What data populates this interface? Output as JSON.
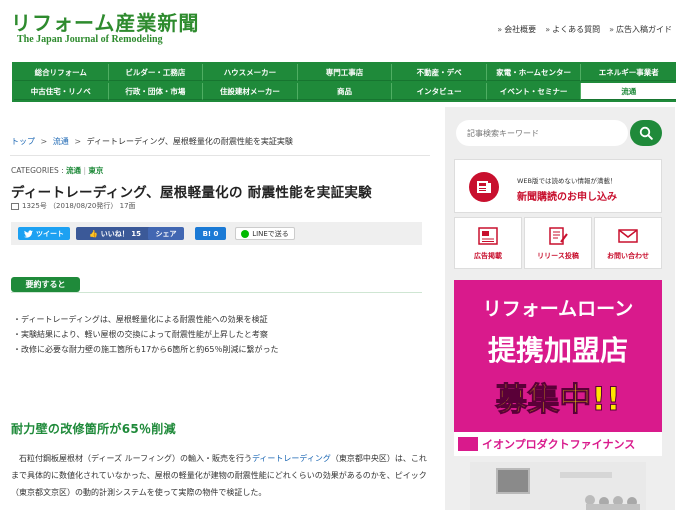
{
  "header": {
    "site_title": "リフォーム産業新聞",
    "site_subtitle": "The Japan Journal of Remodeling",
    "links": [
      "会社概要",
      "よくある質問",
      "広告入稿ガイド"
    ]
  },
  "nav": {
    "row1": [
      "総合リフォーム",
      "ビルダー・工務店",
      "ハウスメーカー",
      "専門工事店",
      "不動産・デベ",
      "家電・ホームセンター",
      "エネルギー事業者"
    ],
    "row2": [
      "中古住宅・リノベ",
      "行政・団体・市場",
      "住設建材メーカー",
      "商品",
      "インタビュー",
      "イベント・セミナー",
      "流通"
    ],
    "active": "流通"
  },
  "breadcrumb": {
    "home": "トップ",
    "category": "流通",
    "current": "ディートレーディング、屋根軽量化の耐震性能を実証実験",
    "separator": ">"
  },
  "article": {
    "categories_label": "CATEGORIES :",
    "categories": [
      "流通",
      "東京"
    ],
    "title": "ディートレーディング、屋根軽量化の 耐震性能を実証実験",
    "issue": "1325号 （2018/08/20発行） 17面",
    "share": {
      "tweet": "ツイート",
      "like": "いいね！ 15",
      "share": "シェア",
      "hatena": "B! 0",
      "line": "LINEで送る"
    },
    "summary_label": "要約すると",
    "summary": [
      "ディートレーディングは、屋根軽量化による耐震性能への効果を検証",
      "実験結果により、軽い屋根の交換によって耐震性能が上昇したと考察",
      "改修に必要な耐力壁の施工箇所も17から6箇所と約65％削減に繋がった"
    ],
    "heading": "耐力壁の改修箇所が65％削減",
    "body_prefix": "　石粒付鋼板屋根材（ディーズ ルーフィング）の輸入・販売を行う",
    "body_link": "ディートレーディング",
    "body_rest": "（東京都中央区）は、これまで具体的に数値化されていなかった、屋根の軽量化が建物の耐震性能にどれくらいの効果があるのかを、ピイック（東京都文京区）の動的計測システムを使って実際の物件で検証した。"
  },
  "sidebar": {
    "search_placeholder": "記事検索キーワード",
    "subscribe_small": "WEB版では読めない情報が満載！",
    "subscribe_big": "新聞購読のお申し込み",
    "quick_links": [
      "広告掲載",
      "リリース投稿",
      "お問い合わせ"
    ],
    "banner": {
      "line1": "リフォームローン",
      "line2": "提携加盟店",
      "line3": "募集中!!",
      "company": "イオンプロダクトファイナンス"
    }
  },
  "colors": {
    "brand_green": "#1f8a3a",
    "link_blue": "#1a66b3",
    "accent_red": "#c8102e",
    "banner_pink": "#d91a8c"
  }
}
